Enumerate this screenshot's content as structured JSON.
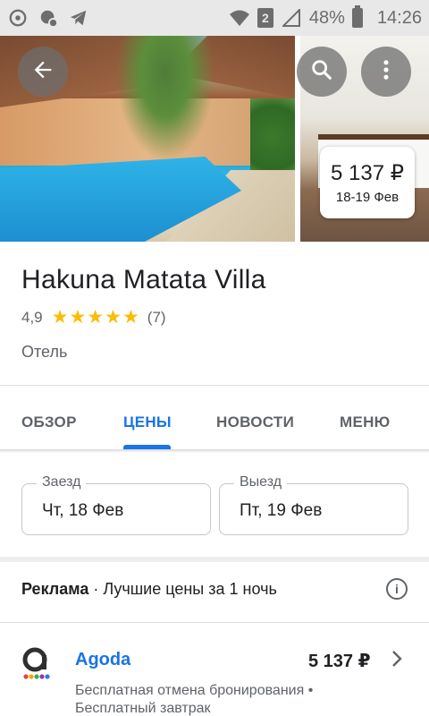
{
  "status_bar": {
    "battery": "48%",
    "time": "14:26",
    "sim": "2",
    "icons": [
      "sync-icon",
      "settings-notify-icon",
      "telegram-icon",
      "wifi-icon",
      "signal-icon",
      "battery-icon"
    ]
  },
  "hero": {
    "price": "5 137 ₽",
    "dates": "18-19 Фев",
    "buttons": [
      "back-arrow-icon",
      "search-icon",
      "more-vert-icon"
    ]
  },
  "hotel": {
    "name": "Hakuna Matata Villa",
    "rating": "4,9",
    "stars": 5,
    "reviews": "(7)",
    "category": "Отель"
  },
  "tabs": [
    {
      "label": "ОБЗОР",
      "active": false
    },
    {
      "label": "ЦЕНЫ",
      "active": true
    },
    {
      "label": "НОВОСТИ",
      "active": false
    },
    {
      "label": "МЕНЮ",
      "active": false
    }
  ],
  "dates": {
    "checkin_label": "Заезд",
    "checkin_value": "Чт, 18 Фев",
    "checkout_label": "Выезд",
    "checkout_value": "Пт, 19 Фев"
  },
  "ad": {
    "label": "Реклама",
    "separator": " · ",
    "text": "Лучшие цены за 1 ночь"
  },
  "offers": [
    {
      "name": "Agoda",
      "price": "5 137 ₽",
      "line1": "Бесплатная отмена бронирования •",
      "line2": "Бесплатный завтрак"
    }
  ],
  "colors": {
    "accent": "#1a73e8",
    "star": "#fbbc04",
    "text": "#202124",
    "secondary": "#5f6368"
  }
}
